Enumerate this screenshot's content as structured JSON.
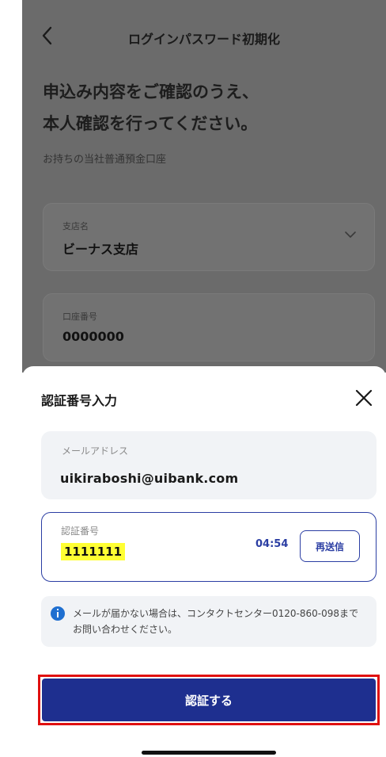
{
  "nav": {
    "title": "ログインパスワード初期化",
    "back_icon": "chevron-left-icon"
  },
  "main": {
    "heading_line1": "申込み内容をご確認のうえ、",
    "heading_line2": "本人確認を行ってください。",
    "subtext": "お持ちの当社普通預金口座",
    "branch": {
      "label": "支店名",
      "value": "ビーナス支店",
      "icon": "chevron-down-icon"
    },
    "account": {
      "label": "口座番号",
      "value": "0000000"
    }
  },
  "sheet": {
    "title": "認証番号入力",
    "close_icon": "close-icon",
    "email": {
      "label": "メールアドレス",
      "value": "uikiraboshi@uibank.com"
    },
    "code": {
      "label": "認証番号",
      "value": "1111111",
      "timer": "04:54",
      "resend_label": "再送信"
    },
    "info": {
      "icon": "info-icon",
      "text": "メールが届かない場合は、コンタクトセンター0120-860-098までお問い合わせください。"
    },
    "submit_label": "認証する"
  },
  "colors": {
    "primary": "#1e2f8f",
    "accent_blue": "#2b3ea3",
    "highlight": "#ffff33",
    "annotation_red": "#e01010",
    "overlay_gray": "#6b6b6b"
  }
}
